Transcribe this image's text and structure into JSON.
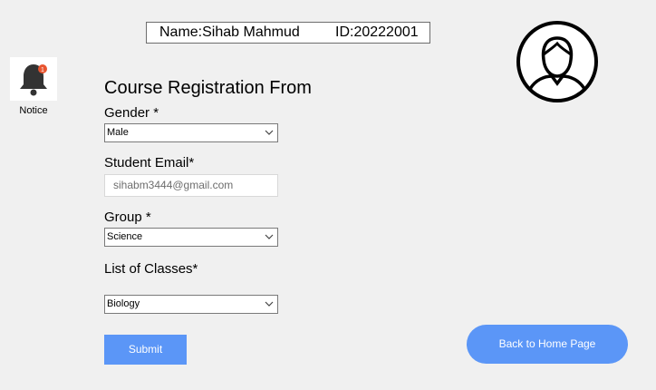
{
  "header": {
    "name_text": "Name:Sihab Mahmud",
    "id_text": "ID:20222001"
  },
  "notice": {
    "label": "Notice",
    "badge_count": "1",
    "icon": "bell-icon"
  },
  "avatar": {
    "icon": "user-avatar-icon"
  },
  "form": {
    "title": "Course Registration From",
    "gender": {
      "label": "Gender *",
      "value": "Male"
    },
    "email": {
      "label": "Student Email*",
      "value": "sihabm3444@gmail.com"
    },
    "group": {
      "label": "Group *",
      "value": "Science"
    },
    "classes": {
      "label": "List of Classes*",
      "value": "Biology"
    },
    "submit_label": "Submit"
  },
  "nav": {
    "home_label": "Back to Home Page"
  },
  "colors": {
    "accent": "#5b96f7",
    "badge": "#e8542f"
  }
}
